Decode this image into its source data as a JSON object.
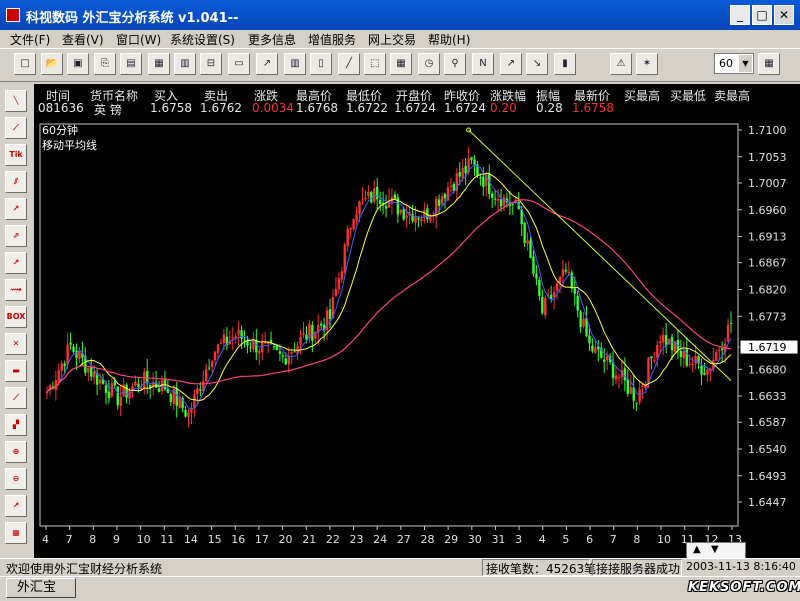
{
  "window": {
    "title": "科视数码 外汇宝分析系统 v1.041--",
    "minimize": "_",
    "maximize": "□",
    "close": "✕"
  },
  "menu": [
    "文件(F)",
    "查看(V)",
    "窗口(W)",
    "系统设置(S)",
    "更多信息",
    "增值服务",
    "网上交易",
    "帮助(H)"
  ],
  "toolbar": {
    "period": "60"
  },
  "left_tools": [
    "trend-line",
    "fan-line",
    "Tik",
    "channel",
    "arrow-up",
    "parallel",
    "ray",
    "zigzag",
    "BOX",
    "delete",
    "eraser",
    "chart-a",
    "chart-b",
    "zoom-in",
    "zoom-out",
    "line-chart",
    "bar-chart"
  ],
  "quote": {
    "headers": [
      "时间",
      "货币名称",
      "买入",
      "卖出",
      "涨跌",
      "最高价",
      "最低价",
      "开盘价",
      "昨收价",
      "涨跌幅",
      "振幅",
      "最新价",
      "买最高",
      "买最低",
      "卖最高"
    ],
    "values": [
      "081636",
      "英  镑",
      "1.6758",
      "1.6762",
      "0.0034",
      "1.6768",
      "1.6722",
      "1.6724",
      "1.6724",
      "0.20",
      "0.28",
      "1.6758"
    ],
    "up_color": "#ff3030"
  },
  "chart": {
    "period_label": "60分钟",
    "indicator_label": "移动平均线",
    "y_ticks": [
      "1.7100",
      "1.7053",
      "1.7007",
      "1.6960",
      "1.6913",
      "1.6867",
      "1.6820",
      "1.6773",
      "1.6719",
      "1.6680",
      "1.6633",
      "1.6587",
      "1.6540",
      "1.6493",
      "1.6447"
    ],
    "current_price": "1.6719",
    "x_ticks": [
      "4",
      "7",
      "8",
      "9",
      "10",
      "11",
      "14",
      "15",
      "16",
      "17",
      "20",
      "21",
      "22",
      "23",
      "24",
      "27",
      "28",
      "29",
      "30",
      "31",
      "3",
      "4",
      "5",
      "6",
      "7",
      "8",
      "10",
      "11",
      "12",
      "13"
    ],
    "colors": {
      "up": "#ff3030",
      "down": "#30ff30",
      "ma_short": "#ffff40",
      "ma_mid": "#4060ff",
      "ma_long": "#ff4080",
      "trend": "#c8ff40",
      "axis": "#c0c0c0"
    }
  },
  "chart_data": {
    "type": "candlestick",
    "title": "60分钟",
    "ylim": [
      1.6447,
      1.71
    ],
    "anchor_closes": [
      {
        "x": "4",
        "y": 1.664
      },
      {
        "x": "7",
        "y": 1.672
      },
      {
        "x": "8",
        "y": 1.667
      },
      {
        "x": "9",
        "y": 1.663
      },
      {
        "x": "10",
        "y": 1.666
      },
      {
        "x": "11",
        "y": 1.665
      },
      {
        "x": "14",
        "y": 1.66
      },
      {
        "x": "15",
        "y": 1.671
      },
      {
        "x": "16",
        "y": 1.674
      },
      {
        "x": "17",
        "y": 1.672
      },
      {
        "x": "20",
        "y": 1.67
      },
      {
        "x": "21",
        "y": 1.674
      },
      {
        "x": "22",
        "y": 1.677
      },
      {
        "x": "23",
        "y": 1.696
      },
      {
        "x": "24",
        "y": 1.699
      },
      {
        "x": "27",
        "y": 1.696
      },
      {
        "x": "28",
        "y": 1.695
      },
      {
        "x": "29",
        "y": 1.7
      },
      {
        "x": "30",
        "y": 1.704
      },
      {
        "x": "31",
        "y": 1.699
      },
      {
        "x": "3",
        "y": 1.696
      },
      {
        "x": "4",
        "y": 1.678
      },
      {
        "x": "5",
        "y": 1.685
      },
      {
        "x": "6",
        "y": 1.672
      },
      {
        "x": "7",
        "y": 1.668
      },
      {
        "x": "8",
        "y": 1.663
      },
      {
        "x": "10",
        "y": 1.674
      },
      {
        "x": "11",
        "y": 1.67
      },
      {
        "x": "12",
        "y": 1.668
      },
      {
        "x": "13",
        "y": 1.676
      }
    ]
  },
  "status": {
    "welcome": "欢迎使用外汇宝财经分析系统",
    "ticks": "接收笔数：45263笔",
    "server": "接接服务器成功",
    "time": "2003-11-13 8:16:40"
  },
  "taskbar": {
    "app": "外汇宝",
    "watermark": "KEKSOFT.COM"
  }
}
